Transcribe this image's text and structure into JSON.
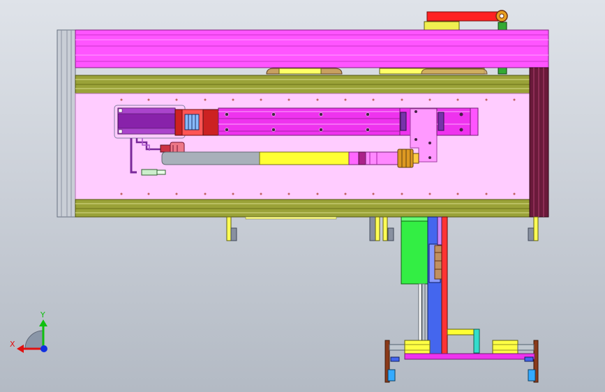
{
  "view": {
    "background_top": "#dfe3e9",
    "background_bottom": "#b3bac4",
    "axis_labels": {
      "x": "X",
      "y": "Y"
    },
    "axis_colors": {
      "x": "#e01010",
      "y": "#10c010",
      "z": "#1030e0"
    }
  },
  "colors": {
    "magenta": "#ff33ff",
    "pink_light": "#ff66ff",
    "pink_panel": "#ffccff",
    "olive": "#99a033",
    "olive_light": "#c8cc6a",
    "purple": "#9933cc",
    "red": "#ff2222",
    "yellow": "#ffff33",
    "green": "#22ee44",
    "blue": "#4466ee",
    "cyan": "#22ccdd",
    "maroon": "#661133",
    "gray": "#aab0b8",
    "dark_gray": "#556070",
    "orange": "#cc8800"
  }
}
